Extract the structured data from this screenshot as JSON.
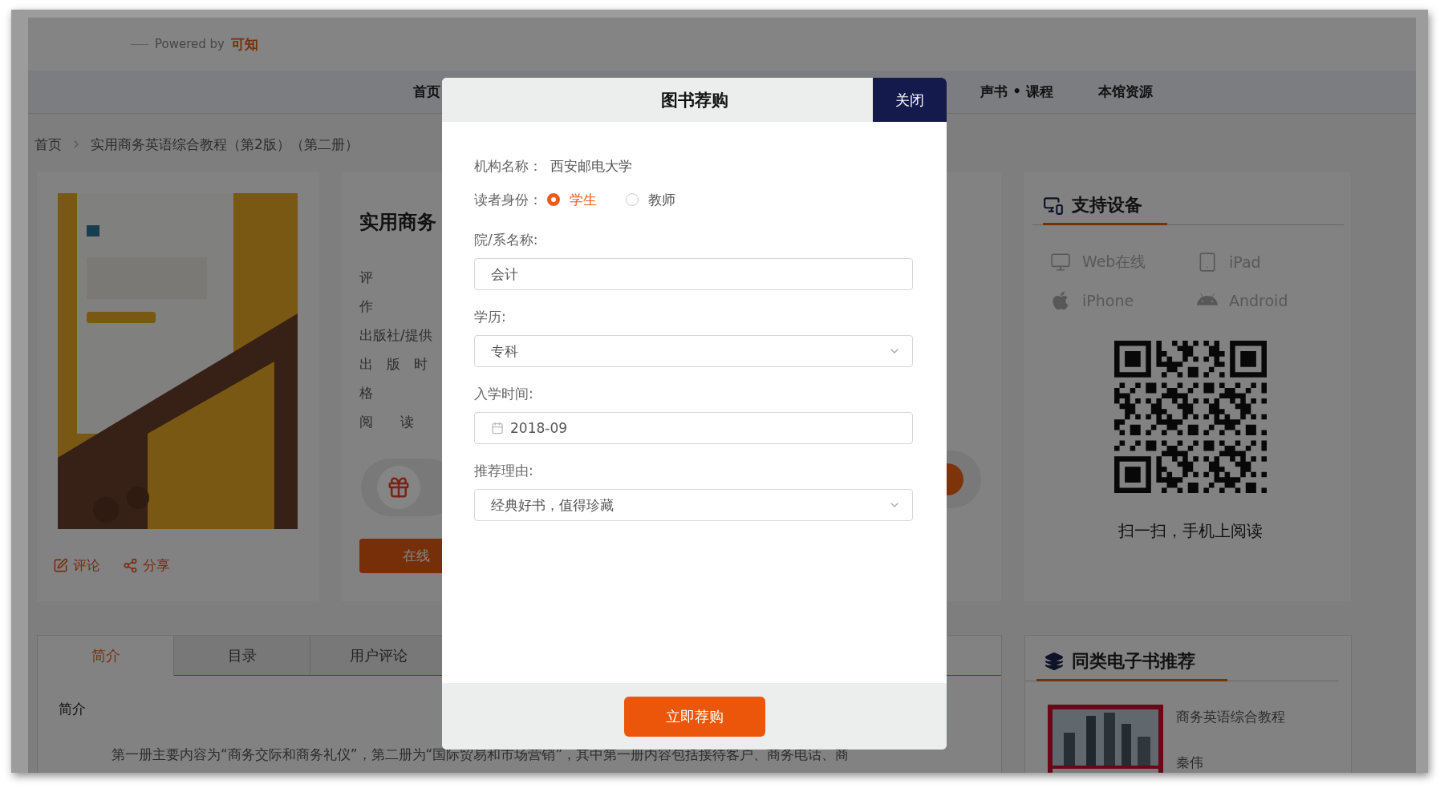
{
  "header": {
    "powered_by": "Powered by",
    "brand": "可知"
  },
  "nav": {
    "left_items": [
      "首页"
    ],
    "right_items": [
      "声书 • 课程",
      "本馆资源"
    ]
  },
  "breadcrumb": [
    "首页",
    "实用商务英语综合教程（第2版）（第二册）"
  ],
  "book_card": {
    "actions": [
      {
        "kind": "comment",
        "label": "评论"
      },
      {
        "kind": "share",
        "label": "分享"
      }
    ]
  },
  "info_card": {
    "title": "实用商务",
    "fields": [
      "评",
      "作",
      "出版社/提供",
      "出　版　时",
      "格",
      "阅　　读"
    ],
    "read_button": "在线"
  },
  "devices_card": {
    "title": "支持设备",
    "devices": [
      {
        "kind": "web",
        "label": "Web在线"
      },
      {
        "kind": "tablet",
        "label": "iPad"
      },
      {
        "kind": "apple",
        "label": "iPhone"
      },
      {
        "kind": "android",
        "label": "Android"
      }
    ],
    "qr_caption": "扫一扫，手机上阅读"
  },
  "detail_tabs": {
    "tabs": [
      {
        "label": "简介",
        "selected": true
      },
      {
        "label": "目录",
        "selected": false
      },
      {
        "label": "用户评论",
        "selected": false
      }
    ],
    "heading": "简介",
    "paragraph": "第一册主要内容为“商务交际和商务礼仪”，第二册为“国际贸易和市场营销”，其中第一册内容包括接待客户、商务电话、商"
  },
  "recommend_card": {
    "title": "同类电子书推荐",
    "books": [
      {
        "title": "商务英语综合教程",
        "author": "秦伟"
      }
    ]
  },
  "modal": {
    "title": "图书荐购",
    "close": "关闭",
    "fields": [
      {
        "kind": "static",
        "label": "机构名称：",
        "value": "西安邮电大学"
      },
      {
        "kind": "radio",
        "label": "读者身份：",
        "options": [
          {
            "label": "学生",
            "selected": true
          },
          {
            "label": "教师",
            "selected": false
          }
        ]
      },
      {
        "kind": "text",
        "label": "院/系名称:",
        "value": "会计"
      },
      {
        "kind": "select",
        "label": "学历:",
        "value": "专科"
      },
      {
        "kind": "date",
        "label": "入学时间:",
        "value": "2018-09"
      },
      {
        "kind": "select",
        "label": "推荐理由:",
        "value": "经典好书，值得珍藏"
      }
    ],
    "submit": "立即荐购"
  }
}
